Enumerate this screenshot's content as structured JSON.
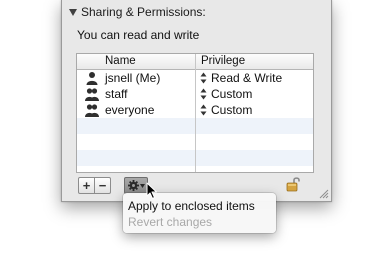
{
  "section": {
    "title": "Sharing & Permissions:",
    "access_text": "You can read and write"
  },
  "table": {
    "columns": {
      "name": "Name",
      "privilege": "Privilege"
    },
    "rows": [
      {
        "name": "jsnell (Me)",
        "privilege": "Read & Write",
        "icon": "single-user-icon"
      },
      {
        "name": "staff",
        "privilege": "Custom",
        "icon": "group-icon"
      },
      {
        "name": "everyone",
        "privilege": "Custom",
        "icon": "group-icon"
      }
    ]
  },
  "toolbar": {
    "add_label": "+",
    "remove_label": "−",
    "action_icon": "gear-icon",
    "lock_icon": "unlocked-padlock-icon"
  },
  "menu": {
    "items": [
      {
        "label": "Apply to enclosed items",
        "enabled": true
      },
      {
        "label": "Revert changes",
        "enabled": false
      }
    ]
  }
}
